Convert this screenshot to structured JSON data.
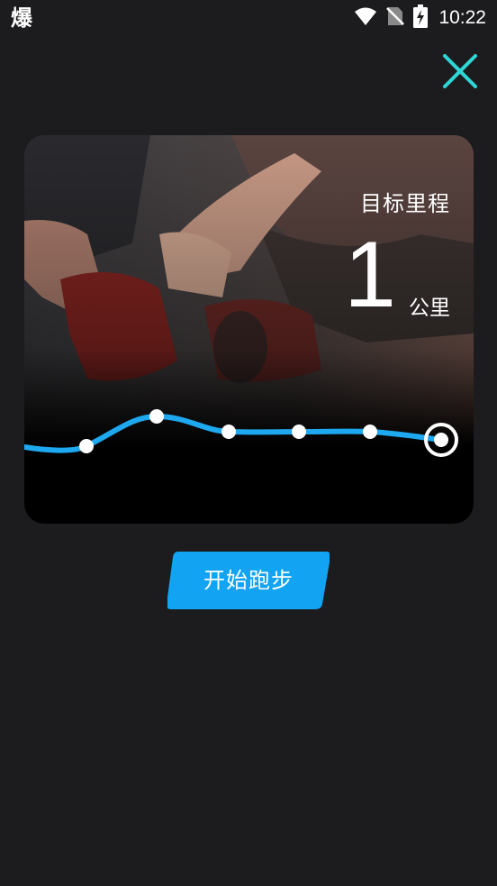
{
  "status_bar": {
    "app_glyph": "爆",
    "time": "10:22",
    "icons": [
      "wifi-icon",
      "no-sim-icon",
      "battery-charging-icon"
    ]
  },
  "close_button": {
    "icon": "close-icon",
    "color": "#2fd6d6"
  },
  "goal_card": {
    "title": "目标里程",
    "distance_value": "1",
    "distance_unit": "公里",
    "line_color": "#1ea8f0",
    "route_points": 7
  },
  "start_button": {
    "label": "开始跑步",
    "color": "#12a3f3"
  },
  "colors": {
    "background": "#1c1c1e",
    "card_background": "#000000",
    "text": "#ffffff"
  }
}
